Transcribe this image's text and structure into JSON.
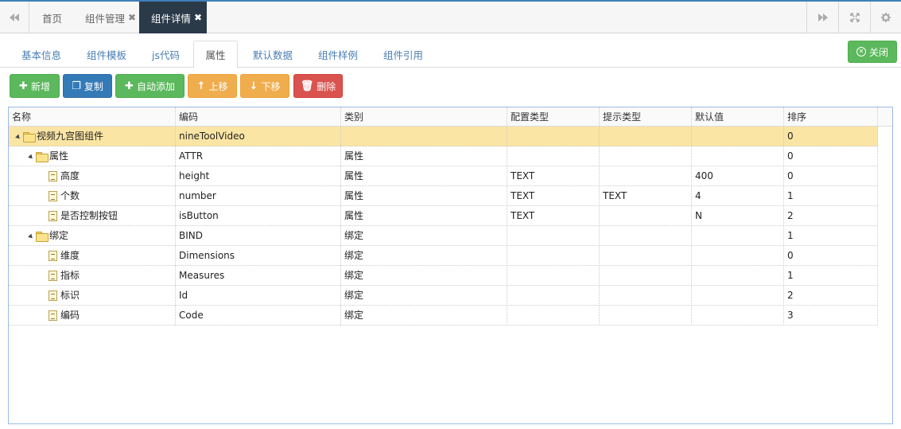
{
  "topbar": {
    "tabs": [
      {
        "label": "首页",
        "closable": false
      },
      {
        "label": "组件管理",
        "closable": true
      },
      {
        "label": "组件详情",
        "closable": true,
        "active": true
      }
    ],
    "close_glyph": "✖"
  },
  "subtabs": [
    {
      "label": "基本信息"
    },
    {
      "label": "组件模板"
    },
    {
      "label": "js代码"
    },
    {
      "label": "属性",
      "active": true
    },
    {
      "label": "默认数据"
    },
    {
      "label": "组件样例"
    },
    {
      "label": "组件引用"
    }
  ],
  "close_button": {
    "label": "关闭"
  },
  "toolbar": {
    "add": "新增",
    "copy": "复制",
    "auto_add": "自动添加",
    "move_up": "上移",
    "move_down": "下移",
    "delete": "删除"
  },
  "colors": {
    "green": "#5cb85c",
    "blue": "#337ab7",
    "orange": "#f0ad4e",
    "red": "#d9534f",
    "active_tab": "#2b3a49",
    "selected_row": "#fbe5a4",
    "accent_line": "#3f7fb8"
  },
  "grid": {
    "columns": [
      "名称",
      "编码",
      "类别",
      "配置类型",
      "提示类型",
      "默认值",
      "排序"
    ],
    "rows": [
      {
        "name": "视频九宫图组件",
        "code": "nineToolVideo",
        "category": "",
        "config_type": "",
        "hint_type": "",
        "default": "",
        "order": "0",
        "depth": 0,
        "node": "folder",
        "expanded": true,
        "selected": true
      },
      {
        "name": "属性",
        "code": "ATTR",
        "category": "属性",
        "config_type": "",
        "hint_type": "",
        "default": "",
        "order": "0",
        "depth": 1,
        "node": "folder",
        "expanded": true
      },
      {
        "name": "高度",
        "code": "height",
        "category": "属性",
        "config_type": "TEXT",
        "hint_type": "",
        "default": "400",
        "order": "0",
        "depth": 2,
        "node": "file"
      },
      {
        "name": "个数",
        "code": "number",
        "category": "属性",
        "config_type": "TEXT",
        "hint_type": "TEXT",
        "default": "4",
        "order": "1",
        "depth": 2,
        "node": "file"
      },
      {
        "name": "是否控制按钮",
        "code": "isButton",
        "category": "属性",
        "config_type": "TEXT",
        "hint_type": "",
        "default": "N",
        "order": "2",
        "depth": 2,
        "node": "file"
      },
      {
        "name": "绑定",
        "code": "BIND",
        "category": "绑定",
        "config_type": "",
        "hint_type": "",
        "default": "",
        "order": "1",
        "depth": 1,
        "node": "folder",
        "expanded": true
      },
      {
        "name": "维度",
        "code": "Dimensions",
        "category": "绑定",
        "config_type": "",
        "hint_type": "",
        "default": "",
        "order": "0",
        "depth": 2,
        "node": "file"
      },
      {
        "name": "指标",
        "code": "Measures",
        "category": "绑定",
        "config_type": "",
        "hint_type": "",
        "default": "",
        "order": "1",
        "depth": 2,
        "node": "file"
      },
      {
        "name": "标识",
        "code": "Id",
        "category": "绑定",
        "config_type": "",
        "hint_type": "",
        "default": "",
        "order": "2",
        "depth": 2,
        "node": "file"
      },
      {
        "name": "编码",
        "code": "Code",
        "category": "绑定",
        "config_type": "",
        "hint_type": "",
        "default": "",
        "order": "3",
        "depth": 2,
        "node": "file"
      }
    ]
  }
}
